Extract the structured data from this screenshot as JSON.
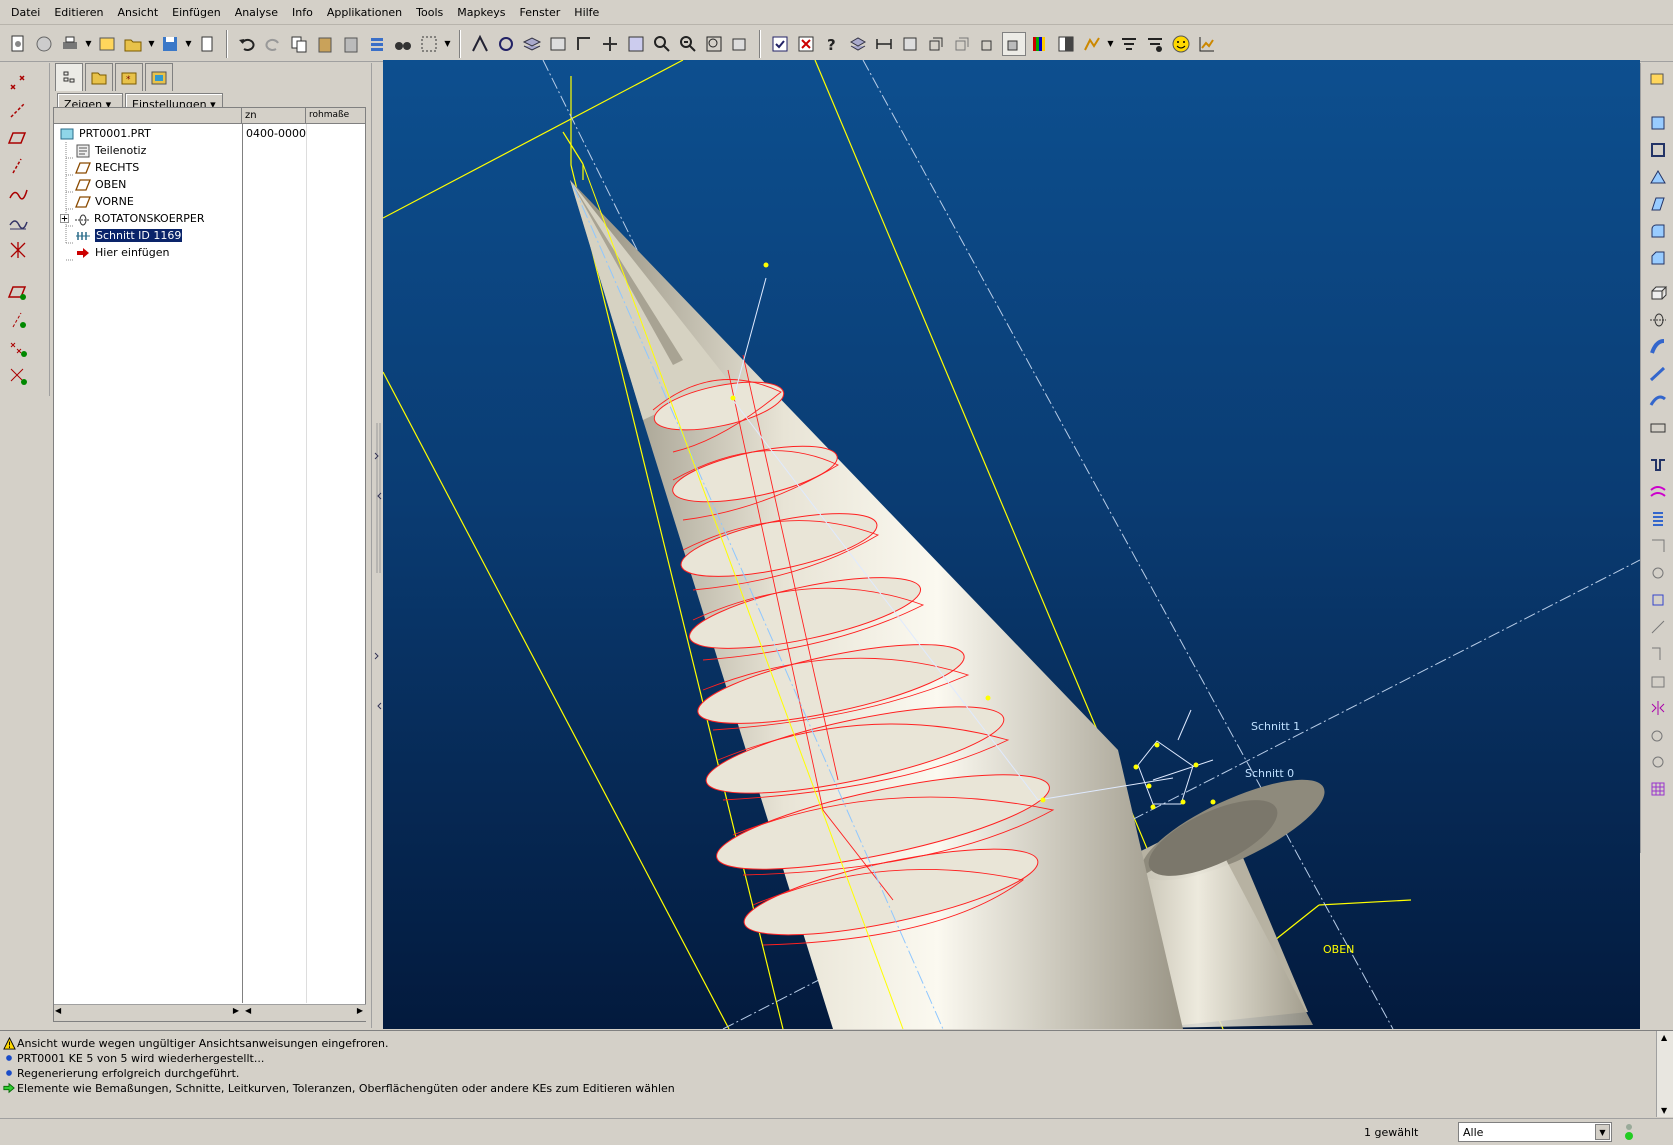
{
  "menu": [
    "Datei",
    "Editieren",
    "Ansicht",
    "Einfügen",
    "Analyse",
    "Info",
    "Applikationen",
    "Tools",
    "Mapkeys",
    "Fenster",
    "Hilfe"
  ],
  "panel": {
    "show_button": "Zeigen ▾",
    "settings_button": "Einstellungen ▾",
    "columns": [
      "zn",
      "rohmaße"
    ]
  },
  "tree": [
    {
      "label": "PRT0001.PRT",
      "value": "0400-0000",
      "icon": "part-icon"
    },
    {
      "label": "Teilenotiz",
      "icon": "note-icon"
    },
    {
      "label": "RECHTS",
      "icon": "datum-plane-icon"
    },
    {
      "label": "OBEN",
      "icon": "datum-plane-icon"
    },
    {
      "label": "VORNE",
      "icon": "datum-plane-icon"
    },
    {
      "label": "ROTATONSKOERPER",
      "icon": "revolve-icon"
    },
    {
      "label": "Schnitt ID 1169",
      "icon": "section-icon",
      "selected": true
    },
    {
      "label": "Hier einfügen",
      "icon": "insert-arrow-icon"
    }
  ],
  "viewport": {
    "labels": {
      "schnitt1": "Schnitt 1",
      "schnitt0": "Schnitt 0",
      "oben": "OBEN"
    },
    "background_top": "#0d4f8f",
    "background_bottom": "#031a3d",
    "datum_color": "#ffff00",
    "curve_color": "#ff0000",
    "body_color": "#e6e3d6"
  },
  "messages": [
    {
      "icon": "warning-icon",
      "text": "Ansicht wurde wegen ungültiger Ansichtsanweisungen eingefroren."
    },
    {
      "icon": "info-icon",
      "text": "PRT0001 KE 5 von 5 wird wiederhergestellt..."
    },
    {
      "icon": "info-icon",
      "text": "Regenerierung erfolgreich durchgeführt."
    },
    {
      "icon": "prompt-icon",
      "text": "Elemente wie Bemaßungen, Schnitte, Leitkurven, Toleranzen, Oberflächengüten oder andere KEs zum Editieren wählen"
    }
  ],
  "status": {
    "selected": "1 gewählt",
    "filter": "Alle"
  }
}
